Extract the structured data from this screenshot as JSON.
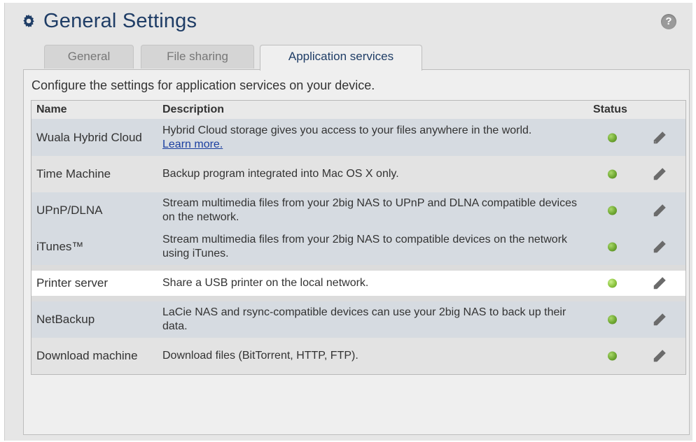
{
  "header": {
    "title": "General Settings",
    "gear_icon": "gear-icon",
    "help_label": "?"
  },
  "tabs": [
    {
      "label": "General",
      "active": false
    },
    {
      "label": "File sharing",
      "active": false
    },
    {
      "label": "Application services",
      "active": true
    }
  ],
  "intro": "Configure the settings for application services on your device.",
  "table": {
    "columns": [
      "Name",
      "Description",
      "Status"
    ],
    "rows": [
      {
        "name": "Wuala Hybrid Cloud",
        "description": "Hybrid Cloud storage gives you access to your files anywhere in the world.",
        "link": "Learn more.",
        "status": "on"
      },
      {
        "name": "Time Machine",
        "description": "Backup program integrated into Mac OS X only.",
        "status": "on"
      },
      {
        "name": "UPnP/DLNA",
        "description": "Stream multimedia files from your 2big NAS to UPnP and DLNA compatible devices on the network.",
        "status": "on"
      },
      {
        "name": "iTunes™",
        "description": "Stream multimedia files from your 2big NAS to compatible devices on the network using iTunes.",
        "status": "on"
      },
      {
        "name": "Printer server",
        "description": "Share a USB printer on the local network.",
        "status": "on",
        "highlighted": true
      },
      {
        "name": "NetBackup",
        "description": "LaCie NAS and rsync-compatible devices can use your 2big NAS to back up their data.",
        "status": "on"
      },
      {
        "name": "Download machine",
        "description": "Download files (BitTorrent, HTTP, FTP).",
        "status": "on"
      }
    ]
  },
  "colors": {
    "title": "#1f3d66",
    "status_on": "#6fa832",
    "row_alt": "#d6dbe1"
  }
}
